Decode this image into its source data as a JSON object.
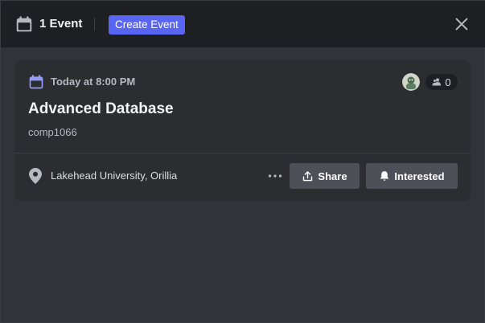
{
  "header": {
    "event_count_label": "1 Event",
    "create_button_label": "Create Event",
    "icons": {
      "calendar": "calendar-icon",
      "close": "close-icon"
    }
  },
  "event": {
    "time": "Today at 8:00 PM",
    "title": "Advanced Database",
    "description": "comp1066",
    "location": "Lakehead University, Orillia",
    "interested_count": "0",
    "actions": {
      "share_label": "Share",
      "interested_label": "Interested"
    },
    "icons": {
      "calendar": "calendar-icon",
      "people": "people-icon",
      "location": "location-pin-icon",
      "more": "more-horizontal-icon",
      "share": "share-icon",
      "bell": "bell-icon"
    }
  },
  "colors": {
    "accent": "#5865f2",
    "header_bg": "#1e1f22",
    "modal_bg": "#313338",
    "card_bg": "#2b2d31",
    "button_bg": "#4e5058"
  }
}
